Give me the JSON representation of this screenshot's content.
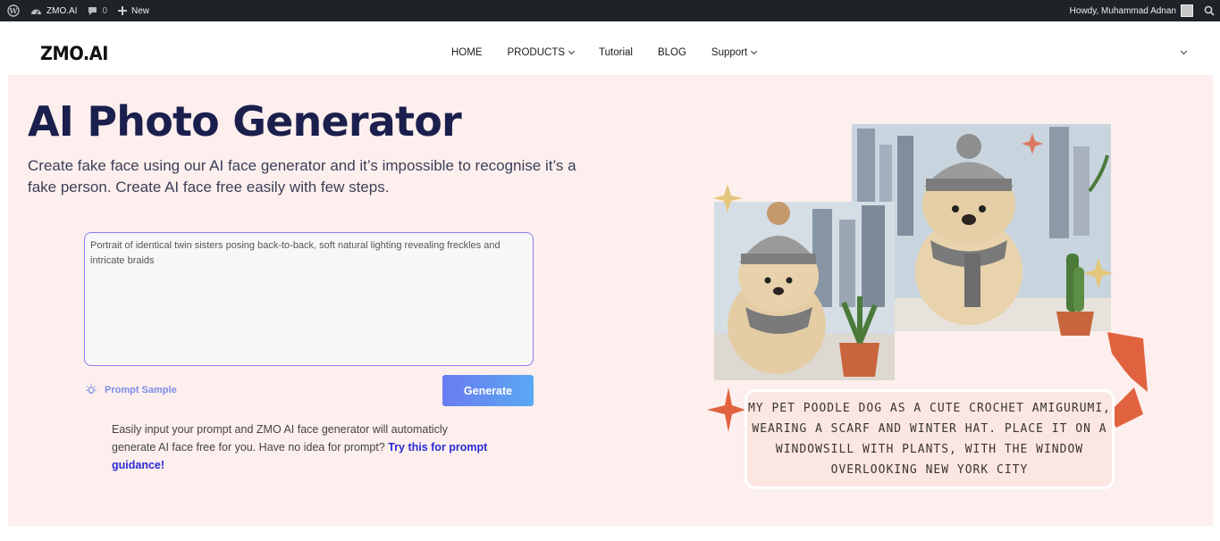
{
  "admin_bar": {
    "site_name": "ZMO.AI",
    "comments_count": "0",
    "new_label": "New",
    "greeting": "Howdy, Muhammad Adnan"
  },
  "header": {
    "logo": "ZMO.AI",
    "nav": [
      {
        "label": "HOME"
      },
      {
        "label": "PRODUCTS"
      },
      {
        "label": "Tutorial"
      },
      {
        "label": "BLOG"
      },
      {
        "label": "Support"
      }
    ]
  },
  "hero": {
    "title": "AI Photo Generator",
    "subtitle": "Create fake face using our AI face generator and it’s impossible to recognise it’s a fake person. Create AI face free easily with few steps.",
    "prompt_value": "Portrait of identical twin sisters posing back-to-back, soft natural lighting revealing freckles and intricate braids",
    "prompt_sample_label": "Prompt Sample",
    "generate_label": "Generate",
    "help_text": "Easily input your prompt and ZMO AI face generator will automaticly generate AI face free for you. Have no idea for prompt? ",
    "help_link": "Try this for prompt guidance!"
  },
  "illustration": {
    "caption": "MY PET POODLE DOG AS A CUTE CROCHET AMIGURUMI, WEARING A SCARF AND WINTER HAT. PLACE IT ON A WINDOWSILL WITH PLANTS, WITH THE WINDOW OVERLOOKING NEW YORK CITY"
  },
  "colors": {
    "admin_bar": "#1d2327",
    "hero_bg": "#fdefed",
    "title": "#1b1f4d",
    "accent": "#6a7cf0",
    "arrow": "#e0623f"
  }
}
